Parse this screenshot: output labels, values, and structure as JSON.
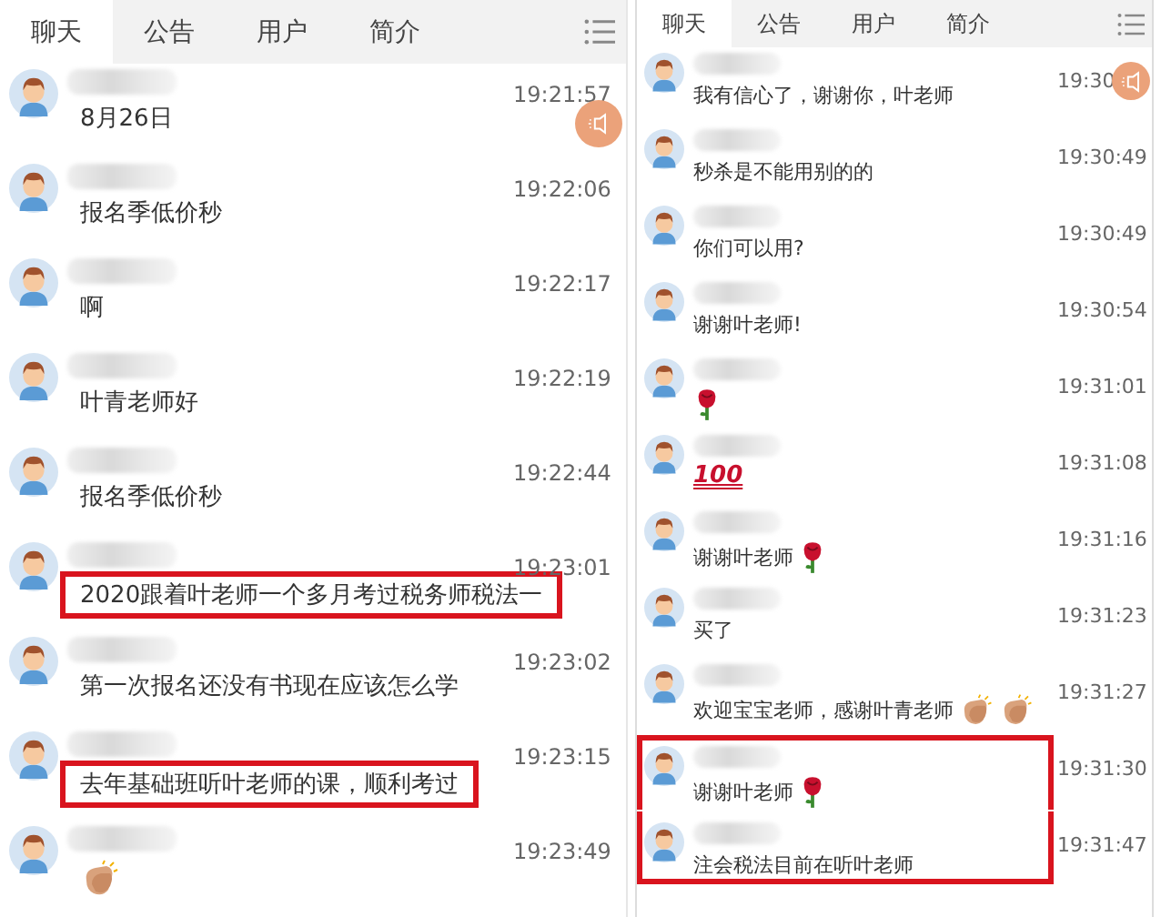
{
  "panels": [
    {
      "kind": "wide",
      "tabs": [
        {
          "label": "聊天",
          "selected": true
        },
        {
          "label": "公告",
          "selected": false
        },
        {
          "label": "用户",
          "selected": false
        },
        {
          "label": "简介",
          "selected": false
        }
      ],
      "messages": [
        {
          "time": "19:21:57",
          "parts": [
            {
              "kind": "text",
              "text": "8月26日"
            }
          ]
        },
        {
          "time": "19:22:06",
          "parts": [
            {
              "kind": "text",
              "text": "报名季低价秒"
            }
          ]
        },
        {
          "time": "19:22:17",
          "parts": [
            {
              "kind": "text",
              "text": "啊"
            }
          ]
        },
        {
          "time": "19:22:19",
          "parts": [
            {
              "kind": "text",
              "text": "叶青老师好"
            }
          ]
        },
        {
          "time": "19:22:44",
          "parts": [
            {
              "kind": "text",
              "text": "报名季低价秒"
            }
          ]
        },
        {
          "time": "19:23:01",
          "highlighted": true,
          "parts": [
            {
              "kind": "text",
              "text": "2020跟着叶老师一个多月考过税务师税法一"
            }
          ]
        },
        {
          "time": "19:23:02",
          "parts": [
            {
              "kind": "text",
              "text": "第一次报名还没有书现在应该怎么学"
            }
          ]
        },
        {
          "time": "19:23:15",
          "highlighted": true,
          "parts": [
            {
              "kind": "text",
              "text": "去年基础班听叶老师的课，顺利考过"
            }
          ]
        },
        {
          "time": "19:23:49",
          "parts": [
            {
              "kind": "clap"
            }
          ]
        }
      ]
    },
    {
      "kind": "narrow",
      "tabs": [
        {
          "label": "聊天",
          "selected": true
        },
        {
          "label": "公告",
          "selected": false
        },
        {
          "label": "用户",
          "selected": false
        },
        {
          "label": "简介",
          "selected": false
        }
      ],
      "messages": [
        {
          "time": "19:30",
          "parts": [
            {
              "kind": "text",
              "text": "我有信心了，谢谢你，叶老师"
            }
          ]
        },
        {
          "time": "19:30:49",
          "parts": [
            {
              "kind": "text",
              "text": "秒杀是不能用别的的"
            }
          ]
        },
        {
          "time": "19:30:49",
          "parts": [
            {
              "kind": "text",
              "text": "你们可以用?"
            }
          ]
        },
        {
          "time": "19:30:54",
          "parts": [
            {
              "kind": "text",
              "text": "谢谢叶老师!"
            }
          ]
        },
        {
          "time": "19:31:01",
          "parts": [
            {
              "kind": "rose"
            }
          ]
        },
        {
          "time": "19:31:08",
          "parts": [
            {
              "kind": "hundred",
              "text": "100"
            }
          ]
        },
        {
          "time": "19:31:16",
          "parts": [
            {
              "kind": "text",
              "text": "谢谢叶老师"
            },
            {
              "kind": "rose"
            }
          ]
        },
        {
          "time": "19:31:23",
          "parts": [
            {
              "kind": "text",
              "text": "买了"
            }
          ]
        },
        {
          "time": "19:31:27",
          "parts": [
            {
              "kind": "text",
              "text": "欢迎宝宝老师，感谢叶青老师"
            },
            {
              "kind": "clap"
            },
            {
              "kind": "clap"
            }
          ]
        },
        {
          "time": "19:31:30",
          "highlighted": true,
          "parts": [
            {
              "kind": "text",
              "text": "谢谢叶老师"
            },
            {
              "kind": "rose"
            }
          ]
        },
        {
          "time": "19:31:47",
          "highlighted": true,
          "parts": [
            {
              "kind": "text",
              "text": "注会税法目前在听叶老师"
            }
          ]
        }
      ]
    }
  ]
}
